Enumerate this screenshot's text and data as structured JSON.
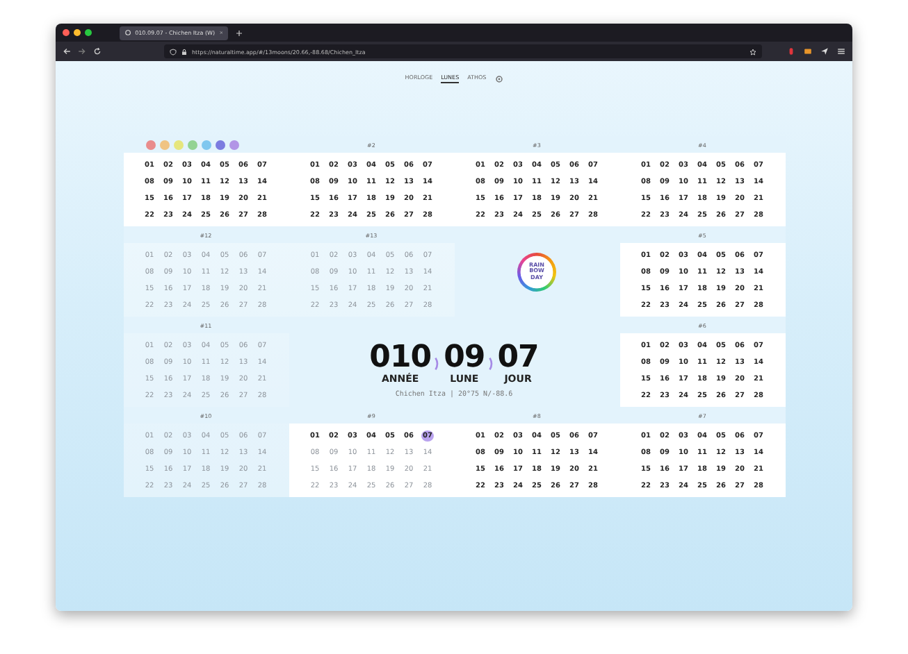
{
  "browser": {
    "tab_title": "010.09.07 - Chichen Itza (W)",
    "url": "https://naturaltime.app/#/13moons/20.66,-88.68/Chichen_Itza"
  },
  "nav": [
    {
      "label": "HORLOGE",
      "selected": false
    },
    {
      "label": "LUNES",
      "selected": true
    },
    {
      "label": "ATHOS",
      "selected": false
    }
  ],
  "color_dots": [
    {
      "color": "#e98c8c"
    },
    {
      "color": "#f0c483"
    },
    {
      "color": "#e6e67e"
    },
    {
      "color": "#93d393"
    },
    {
      "color": "#7fc7ef"
    },
    {
      "color": "#7c7ce0"
    },
    {
      "color": "#b295e6"
    }
  ],
  "months": [
    {
      "done": true,
      "days": [
        "01",
        "02",
        "03",
        "04",
        "05",
        "06",
        "07",
        "08",
        "09",
        "10",
        "11",
        "12",
        "13",
        "14",
        "15",
        "16",
        "17",
        "18",
        "19",
        "20",
        "21",
        "22",
        "23",
        "24",
        "25",
        "26",
        "27",
        "28"
      ]
    },
    {
      "label": "#2",
      "done": true,
      "days": [
        "01",
        "02",
        "03",
        "04",
        "05",
        "06",
        "07",
        "08",
        "09",
        "10",
        "11",
        "12",
        "13",
        "14",
        "15",
        "16",
        "17",
        "18",
        "19",
        "20",
        "21",
        "22",
        "23",
        "24",
        "25",
        "26",
        "27",
        "28"
      ]
    },
    {
      "label": "#3",
      "done": true,
      "days": [
        "01",
        "02",
        "03",
        "04",
        "05",
        "06",
        "07",
        "08",
        "09",
        "10",
        "11",
        "12",
        "13",
        "14",
        "15",
        "16",
        "17",
        "18",
        "19",
        "20",
        "21",
        "22",
        "23",
        "24",
        "25",
        "26",
        "27",
        "28"
      ]
    },
    {
      "label": "#4",
      "done": true,
      "days": [
        "01",
        "02",
        "03",
        "04",
        "05",
        "06",
        "07",
        "08",
        "09",
        "10",
        "11",
        "12",
        "13",
        "14",
        "15",
        "16",
        "17",
        "18",
        "19",
        "20",
        "21",
        "22",
        "23",
        "24",
        "25",
        "26",
        "27",
        "28"
      ]
    },
    {
      "label": "#12",
      "done": false,
      "days": [
        "01",
        "02",
        "03",
        "04",
        "05",
        "06",
        "07",
        "08",
        "09",
        "10",
        "11",
        "12",
        "13",
        "14",
        "15",
        "16",
        "17",
        "18",
        "19",
        "20",
        "21",
        "22",
        "23",
        "24",
        "25",
        "26",
        "27",
        "28"
      ]
    },
    {
      "label": "#13",
      "done": false,
      "days": [
        "01",
        "02",
        "03",
        "04",
        "05",
        "06",
        "07",
        "08",
        "09",
        "10",
        "11",
        "12",
        "13",
        "14",
        "15",
        "16",
        "17",
        "18",
        "19",
        "20",
        "21",
        "22",
        "23",
        "24",
        "25",
        "26",
        "27",
        "28"
      ]
    },
    {
      "label": "#5",
      "done": true,
      "days": [
        "01",
        "02",
        "03",
        "04",
        "05",
        "06",
        "07",
        "08",
        "09",
        "10",
        "11",
        "12",
        "13",
        "14",
        "15",
        "16",
        "17",
        "18",
        "19",
        "20",
        "21",
        "22",
        "23",
        "24",
        "25",
        "26",
        "27",
        "28"
      ]
    },
    {
      "label": "#11",
      "done": false,
      "days": [
        "01",
        "02",
        "03",
        "04",
        "05",
        "06",
        "07",
        "08",
        "09",
        "10",
        "11",
        "12",
        "13",
        "14",
        "15",
        "16",
        "17",
        "18",
        "19",
        "20",
        "21",
        "22",
        "23",
        "24",
        "25",
        "26",
        "27",
        "28"
      ]
    },
    {
      "label": "#6",
      "done": true,
      "days": [
        "01",
        "02",
        "03",
        "04",
        "05",
        "06",
        "07",
        "08",
        "09",
        "10",
        "11",
        "12",
        "13",
        "14",
        "15",
        "16",
        "17",
        "18",
        "19",
        "20",
        "21",
        "22",
        "23",
        "24",
        "25",
        "26",
        "27",
        "28"
      ]
    },
    {
      "label": "#10",
      "done": false,
      "days": [
        "01",
        "02",
        "03",
        "04",
        "05",
        "06",
        "07",
        "08",
        "09",
        "10",
        "11",
        "12",
        "13",
        "14",
        "15",
        "16",
        "17",
        "18",
        "19",
        "20",
        "21",
        "22",
        "23",
        "24",
        "25",
        "26",
        "27",
        "28"
      ]
    },
    {
      "label": "#9",
      "days": [
        {
          "text": "01",
          "done": true,
          "selected": false
        },
        {
          "text": "02",
          "done": true,
          "selected": false
        },
        {
          "text": "03",
          "done": true,
          "selected": false
        },
        {
          "text": "04",
          "done": true,
          "selected": false
        },
        {
          "text": "05",
          "done": true,
          "selected": false
        },
        {
          "text": "06",
          "done": true,
          "selected": false
        },
        {
          "text": "07",
          "done": true,
          "selected": true
        },
        {
          "text": "08",
          "done": false,
          "selected": false
        },
        {
          "text": "09",
          "done": false,
          "selected": false
        },
        {
          "text": "10",
          "done": false,
          "selected": false
        },
        {
          "text": "11",
          "done": false,
          "selected": false
        },
        {
          "text": "12",
          "done": false,
          "selected": false
        },
        {
          "text": "13",
          "done": false,
          "selected": false
        },
        {
          "text": "14",
          "done": false,
          "selected": false
        },
        {
          "text": "15",
          "done": false,
          "selected": false
        },
        {
          "text": "16",
          "done": false,
          "selected": false
        },
        {
          "text": "17",
          "done": false,
          "selected": false
        },
        {
          "text": "18",
          "done": false,
          "selected": false
        },
        {
          "text": "19",
          "done": false,
          "selected": false
        },
        {
          "text": "20",
          "done": false,
          "selected": false
        },
        {
          "text": "21",
          "done": false,
          "selected": false
        },
        {
          "text": "22",
          "done": false,
          "selected": false
        },
        {
          "text": "23",
          "done": false,
          "selected": false
        },
        {
          "text": "24",
          "done": false,
          "selected": false
        },
        {
          "text": "25",
          "done": false,
          "selected": false
        },
        {
          "text": "26",
          "done": false,
          "selected": false
        },
        {
          "text": "27",
          "done": false,
          "selected": false
        },
        {
          "text": "28",
          "done": false,
          "selected": false
        }
      ]
    },
    {
      "label": "#8",
      "done": true,
      "days": [
        "01",
        "02",
        "03",
        "04",
        "05",
        "06",
        "07",
        "08",
        "09",
        "10",
        "11",
        "12",
        "13",
        "14",
        "15",
        "16",
        "17",
        "18",
        "19",
        "20",
        "21",
        "22",
        "23",
        "24",
        "25",
        "26",
        "27",
        "28"
      ]
    },
    {
      "label": "#7",
      "done": true,
      "days": [
        "01",
        "02",
        "03",
        "04",
        "05",
        "06",
        "07",
        "08",
        "09",
        "10",
        "11",
        "12",
        "13",
        "14",
        "15",
        "16",
        "17",
        "18",
        "19",
        "20",
        "21",
        "22",
        "23",
        "24",
        "25",
        "26",
        "27",
        "28"
      ]
    }
  ],
  "logo": {
    "lines": [
      "RAIN",
      "BOW",
      "DAY"
    ]
  },
  "counter": {
    "parts": [
      {
        "value": "010",
        "label": "ANNÉE"
      },
      {
        "value": "09",
        "label": "LUNE"
      },
      {
        "value": "07",
        "label": "JOUR"
      }
    ],
    "location": "Chichen Itza | 20°75 N/-88.6"
  }
}
